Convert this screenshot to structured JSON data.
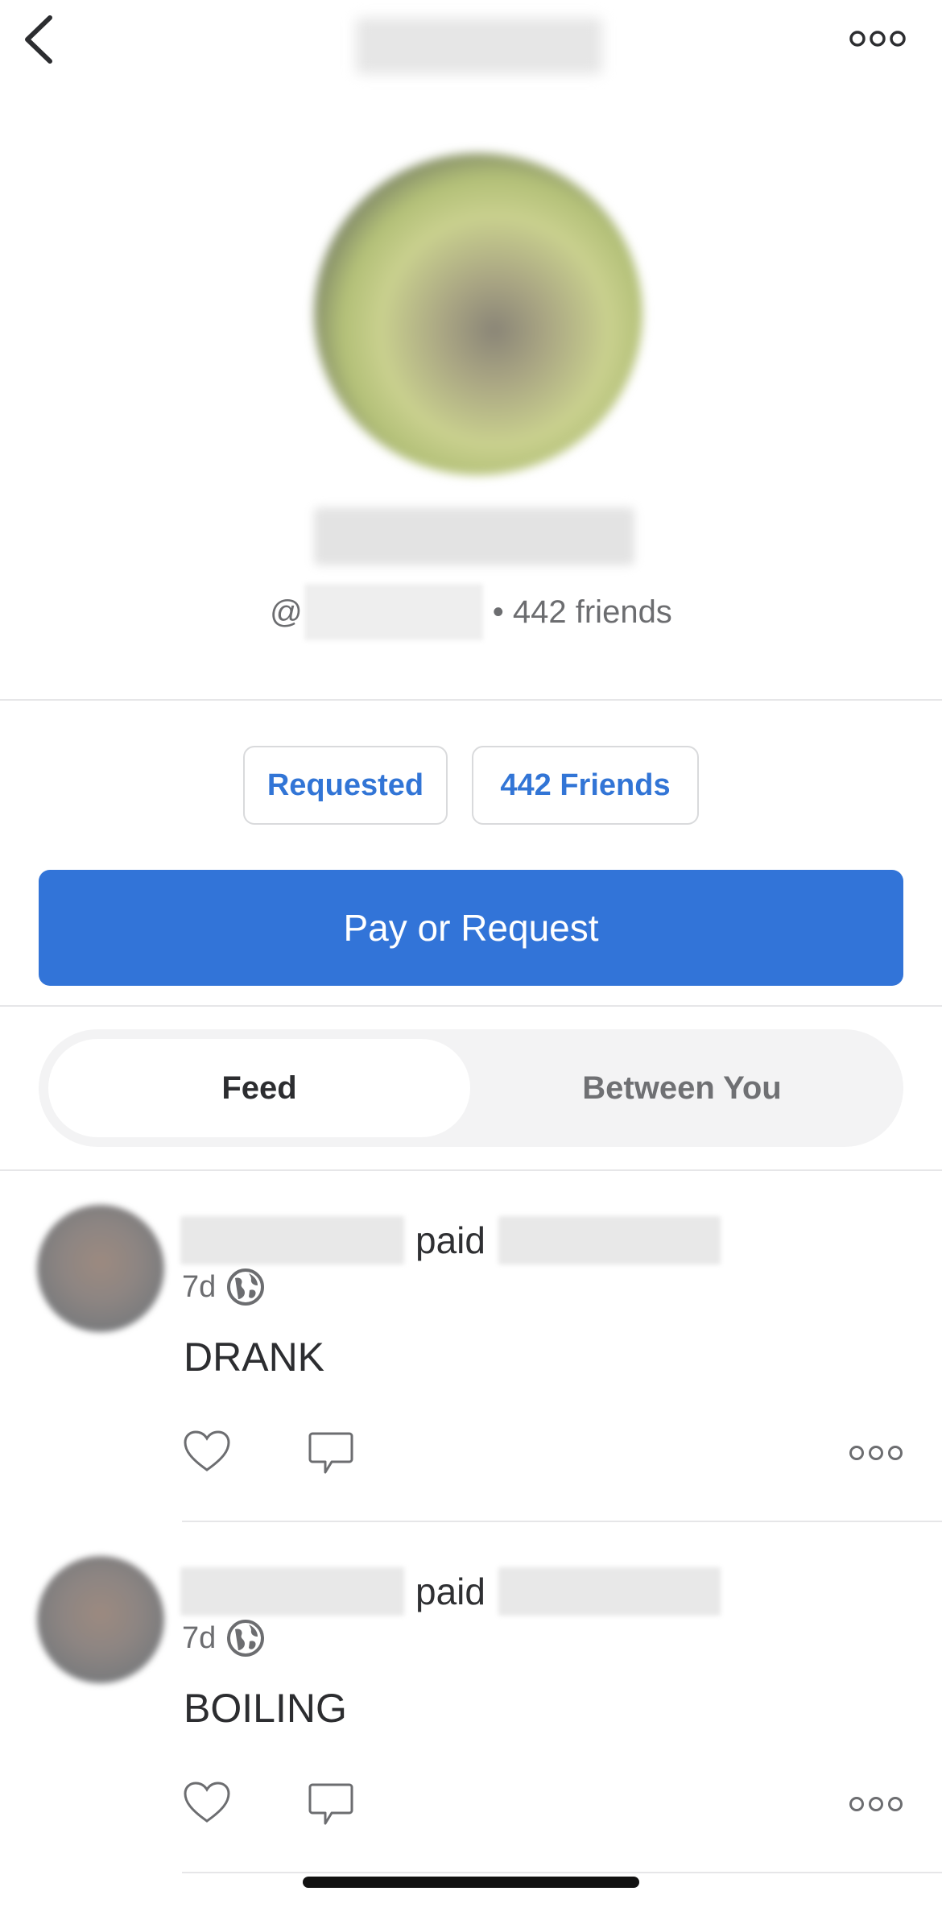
{
  "header": {
    "back_icon": "chevron-left-icon",
    "more_icon": "ellipsis-icon"
  },
  "profile": {
    "handle_prefix": "@",
    "friends_text": "• 442 friends"
  },
  "actions": {
    "requested_label": "Requested",
    "friends_label": "442 Friends",
    "primary_label": "Pay or Request",
    "primary_color": "#3274d8",
    "link_color": "#3275d6"
  },
  "tabs": [
    {
      "label": "Feed",
      "active": true
    },
    {
      "label": "Between You",
      "active": false
    }
  ],
  "feed": [
    {
      "verb": "paid",
      "time": "7d",
      "privacy_icon": "globe-icon",
      "note": "DRANK"
    },
    {
      "verb": "paid",
      "time": "7d",
      "privacy_icon": "globe-icon",
      "note": "BOILING"
    }
  ]
}
